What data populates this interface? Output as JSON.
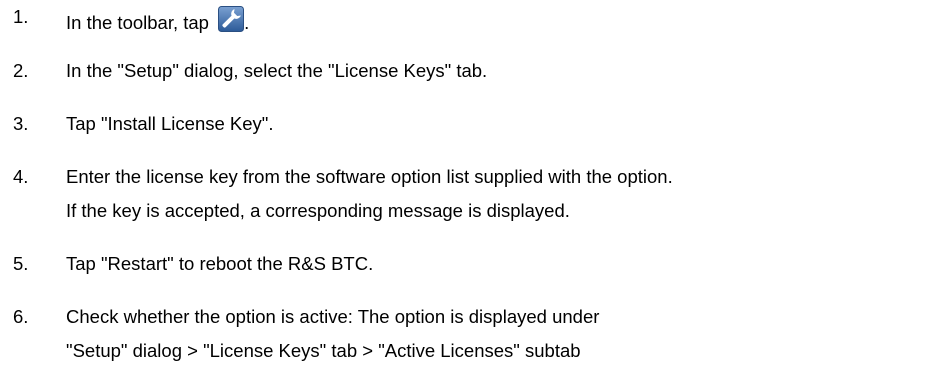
{
  "steps": [
    {
      "number": "1.",
      "text_before_icon": "In the toolbar, tap ",
      "icon": "wrench-icon",
      "text_after_icon": "."
    },
    {
      "number": "2.",
      "text": "In the \"Setup\" dialog, select the \"License Keys\" tab."
    },
    {
      "number": "3.",
      "text": "Tap \"Install License Key\"."
    },
    {
      "number": "4.",
      "lines": [
        "Enter the license key from the software option list supplied with the option.",
        "If the key is accepted, a corresponding message is displayed."
      ]
    },
    {
      "number": "5.",
      "text": "Tap \"Restart\" to reboot the R&S BTC."
    },
    {
      "number": "6.",
      "lines": [
        "Check whether the option is active: The option is displayed under",
        "\"Setup\" dialog > \"License Keys\" tab > \"Active Licenses\" subtab"
      ]
    }
  ],
  "colors": {
    "text": "#000000",
    "icon_bg_top": "#6f96c8",
    "icon_bg_bottom": "#2f5f9e",
    "icon_glyph": "#ffffff"
  }
}
